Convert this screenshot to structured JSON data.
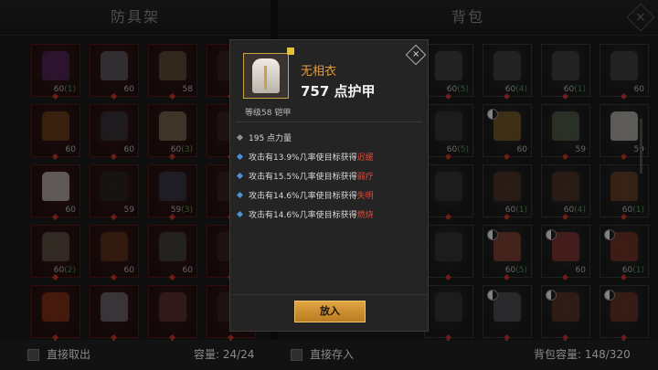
{
  "left_panel": {
    "title": "防具架",
    "footer_checkbox_label": "直接取出",
    "capacity_label": "容量: 24/24",
    "slots": [
      {
        "lvl": "60",
        "cnt": "(1)",
        "color": "#5b2a6a"
      },
      {
        "lvl": "60",
        "cnt": "",
        "color": "#6a6a70"
      },
      {
        "lvl": "58",
        "cnt": "",
        "color": "#6a5a40"
      },
      {
        "lvl": "",
        "cnt": "",
        "color": "#3a2a2a"
      },
      {
        "lvl": "60",
        "cnt": "",
        "color": "#7a4a20"
      },
      {
        "lvl": "60",
        "cnt": "",
        "color": "#3a3a40"
      },
      {
        "lvl": "60",
        "cnt": "(3)",
        "color": "#8a7a5a"
      },
      {
        "lvl": "",
        "cnt": "",
        "color": "#3a2a2a"
      },
      {
        "lvl": "60",
        "cnt": "",
        "color": "#d8d4cc"
      },
      {
        "lvl": "59",
        "cnt": "",
        "color": "#2a2a2a"
      },
      {
        "lvl": "59",
        "cnt": "(3)",
        "color": "#3a4050"
      },
      {
        "lvl": "",
        "cnt": "",
        "color": "#3a2a2a"
      },
      {
        "lvl": "60",
        "cnt": "(2)",
        "color": "#6a6050"
      },
      {
        "lvl": "60",
        "cnt": "",
        "color": "#6a3a20"
      },
      {
        "lvl": "60",
        "cnt": "",
        "color": "#4a4a4a"
      },
      {
        "lvl": "",
        "cnt": "",
        "color": "#3a2a2a"
      },
      {
        "lvl": "",
        "cnt": "",
        "color": "#9a3a1a"
      },
      {
        "lvl": "",
        "cnt": "",
        "color": "#7a7a80"
      },
      {
        "lvl": "",
        "cnt": "",
        "color": "#6a3a3a"
      },
      {
        "lvl": "",
        "cnt": "",
        "color": "#3a2a2a"
      }
    ]
  },
  "right_panel": {
    "title": "背包",
    "footer_checkbox_label": "直接存入",
    "capacity_label": "背包容量: 148/320",
    "slots": [
      {
        "lvl": "60",
        "cnt": "(5)",
        "color": "#4a4a4a",
        "yin": false
      },
      {
        "lvl": "60",
        "cnt": "(4)",
        "color": "#4a4a4a",
        "yin": false
      },
      {
        "lvl": "60",
        "cnt": "(1)",
        "color": "#4a4a4a",
        "yin": false
      },
      {
        "lvl": "60",
        "cnt": "",
        "color": "#4a4a4a",
        "yin": false
      },
      {
        "lvl": "60",
        "cnt": "(5)",
        "color": "#3a3a3a",
        "yin": false
      },
      {
        "lvl": "60",
        "cnt": "",
        "color": "#8a6a2a",
        "yin": true
      },
      {
        "lvl": "59",
        "cnt": "",
        "color": "#5a6a50",
        "yin": false
      },
      {
        "lvl": "59",
        "cnt": "",
        "color": "#d8d4cc",
        "yin": false
      },
      {
        "lvl": "",
        "cnt": "",
        "color": "#3a3a3a",
        "yin": false
      },
      {
        "lvl": "60",
        "cnt": "(1)",
        "color": "#5a3a2a",
        "yin": false
      },
      {
        "lvl": "60",
        "cnt": "(4)",
        "color": "#5a3a2a",
        "yin": false
      },
      {
        "lvl": "60",
        "cnt": "(1)",
        "color": "#7a4a2a",
        "yin": false
      },
      {
        "lvl": "",
        "cnt": "",
        "color": "#3a3a3a",
        "yin": false
      },
      {
        "lvl": "60",
        "cnt": "(5)",
        "color": "#9a4a3a",
        "yin": true
      },
      {
        "lvl": "60",
        "cnt": "",
        "color": "#9a3a3a",
        "yin": true
      },
      {
        "lvl": "60",
        "cnt": "(1)",
        "color": "#8a3a2a",
        "yin": true
      },
      {
        "lvl": "",
        "cnt": "",
        "color": "#3a3a3a",
        "yin": false
      },
      {
        "lvl": "",
        "cnt": "",
        "color": "#5a5a60",
        "yin": true
      },
      {
        "lvl": "",
        "cnt": "",
        "color": "#6a3a2a",
        "yin": true
      },
      {
        "lvl": "",
        "cnt": "",
        "color": "#7a3a2a",
        "yin": true
      }
    ]
  },
  "tooltip": {
    "name": "无相衣",
    "armor": "757 点护甲",
    "meta": "等级58 铠甲",
    "base_stat": "195 点力量",
    "effects": [
      {
        "text": "攻击有13.9%几率使目标获得",
        "status": "迟缓"
      },
      {
        "text": "攻击有15.5%几率使目标获得",
        "status": "弱疗"
      },
      {
        "text": "攻击有14.6%几率使目标获得",
        "status": "失明"
      },
      {
        "text": "攻击有14.6%几率使目标获得",
        "status": "燃烧"
      }
    ],
    "button": "放入",
    "close_symbol": "×"
  },
  "close_symbol": "×",
  "colors": {
    "name": "#e59a3b",
    "status": "#d94b3b",
    "button": "#e0a442",
    "slot_border": "#5a1a1a"
  }
}
